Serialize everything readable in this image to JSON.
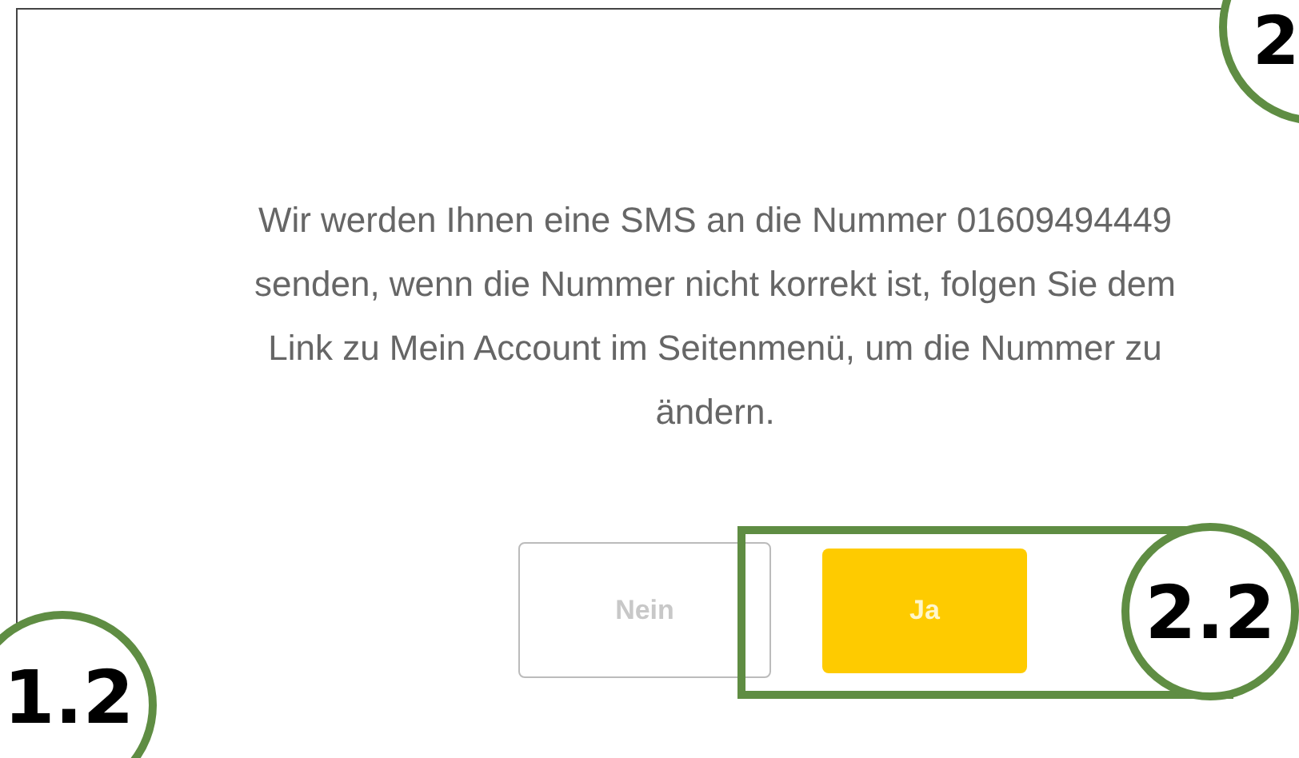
{
  "dialog": {
    "message": "Wir werden Ihnen eine SMS an die Nummer 01609494449 senden, wenn die Nummer nicht korrekt ist, folgen Sie dem Link zu Mein Account im Seitenmenü, um die Nummer zu ändern.",
    "buttons": [
      {
        "label": "Nein",
        "kind": "secondary"
      },
      {
        "label": "Ja",
        "kind": "primary"
      }
    ]
  },
  "annotations": [
    {
      "label": "2",
      "kind": "top-right"
    },
    {
      "label": "1.2",
      "kind": "bottom-left"
    },
    {
      "label": "2.2",
      "kind": "button-group"
    }
  ]
}
